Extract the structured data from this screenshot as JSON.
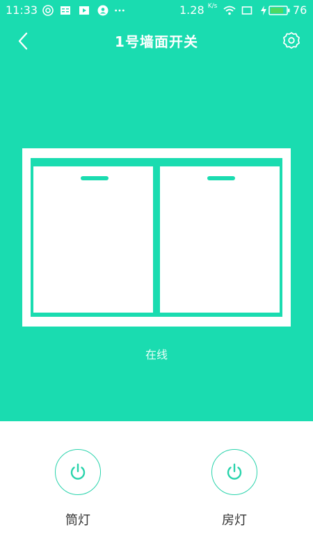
{
  "status_bar": {
    "time": "11:33",
    "net_speed": "1.28",
    "net_speed_unit": "K/s",
    "battery_level": "76",
    "icons": [
      "notification-a-icon",
      "reader-icon",
      "play-icon",
      "account-icon",
      "more-dots-icon",
      "wifi-icon",
      "screen-icon",
      "charging-icon",
      "battery-icon"
    ]
  },
  "header": {
    "title": "1号墙面开关",
    "back_icon": "chevron-left-icon",
    "settings_icon": "gear-icon"
  },
  "device": {
    "status": "在线",
    "gang_count": 2
  },
  "controls": [
    {
      "label": "筒灯",
      "icon": "power-icon"
    },
    {
      "label": "房灯",
      "icon": "power-icon"
    }
  ],
  "colors": {
    "primary": "#1adcb0",
    "accent_stroke": "#28d3ab",
    "background": "#ffffff",
    "label_text": "#333333"
  }
}
